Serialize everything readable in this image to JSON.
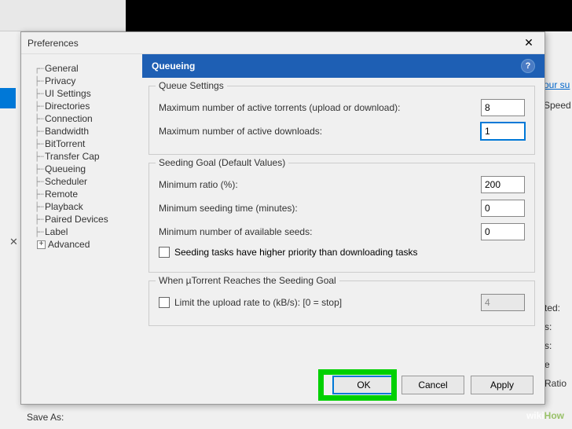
{
  "dialog": {
    "title": "Preferences",
    "close_icon": "✕"
  },
  "tree": {
    "items": [
      "General",
      "Privacy",
      "UI Settings",
      "Directories",
      "Connection",
      "Bandwidth",
      "BitTorrent",
      "Transfer Cap",
      "Queueing",
      "Scheduler",
      "Remote",
      "Playback",
      "Paired Devices",
      "Label"
    ],
    "advanced": "Advanced",
    "expander": "+"
  },
  "content": {
    "header": "Queueing",
    "help_icon": "?",
    "queue_settings": {
      "legend": "Queue Settings",
      "max_active_label": "Maximum number of active torrents (upload or download):",
      "max_active_value": "8",
      "max_downloads_label": "Maximum number of active downloads:",
      "max_downloads_value": "1"
    },
    "seeding_goal": {
      "legend": "Seeding Goal (Default Values)",
      "min_ratio_label": "Minimum ratio (%):",
      "min_ratio_value": "200",
      "min_time_label": "Minimum seeding time (minutes):",
      "min_time_value": "0",
      "min_seeds_label": "Minimum number of available seeds:",
      "min_seeds_value": "0",
      "priority_checkbox": "Seeding tasks have higher priority than downloading tasks"
    },
    "when_goal": {
      "legend": "When µTorrent Reaches the Seeding Goal",
      "limit_checkbox": "Limit the upload rate to (kB/s): [0 = stop]",
      "limit_value": "4"
    }
  },
  "buttons": {
    "ok": "OK",
    "cancel": "Cancel",
    "apply": "Apply"
  },
  "background": {
    "link_text": "our su",
    "col_speed": "Speed",
    "right_items": [
      "ted:",
      "s:",
      "s:",
      "e Ratio"
    ],
    "save_as": "Save As:",
    "close_x": "✕"
  },
  "watermark": {
    "wiki": "wiki",
    "how": "How"
  }
}
